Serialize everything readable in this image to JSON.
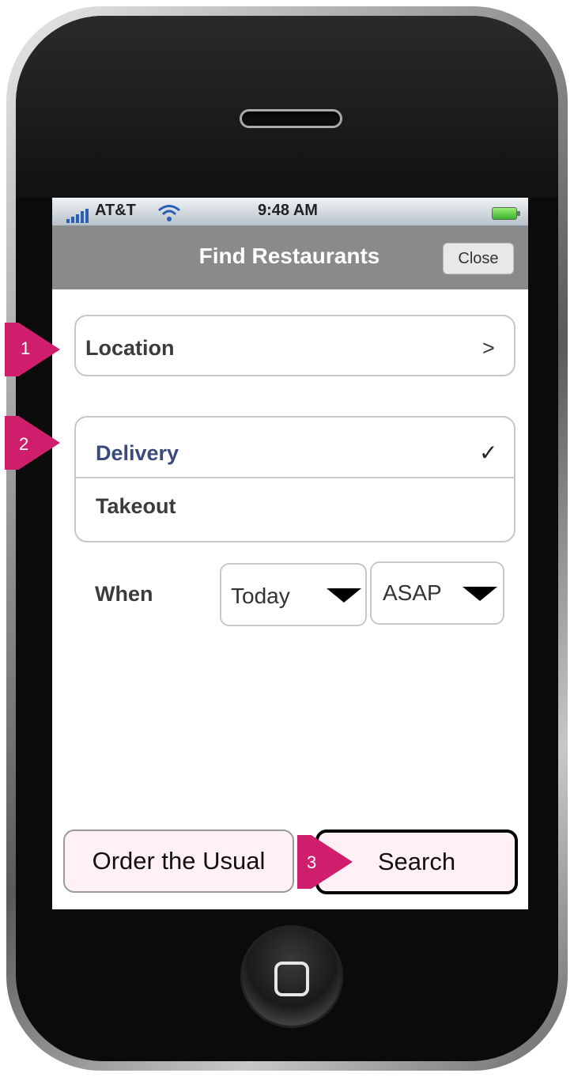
{
  "status_bar": {
    "carrier": "AT&T",
    "time": "9:48 AM",
    "signal_icon": "signal-bars-icon",
    "wifi_icon": "wifi-icon",
    "battery_icon": "battery-icon"
  },
  "nav_bar": {
    "title": "Find Restaurants",
    "close_label": "Close"
  },
  "location": {
    "label": "Location",
    "chevron": ">"
  },
  "order_type": {
    "options": [
      {
        "label": "Delivery",
        "selected": true
      },
      {
        "label": "Takeout",
        "selected": false
      }
    ],
    "check_glyph": "✓"
  },
  "when": {
    "label": "When",
    "day_value": "Today",
    "time_value": "ASAP"
  },
  "actions": {
    "order_usual_label": "Order the Usual",
    "search_label": "Search"
  },
  "callouts": [
    "1",
    "2",
    "3"
  ],
  "colors": {
    "nav_bar": "#8a8a8a",
    "selected_option": "#3b4a7d",
    "callout": "#cf1f6c",
    "button_fill": "#fff1f6"
  }
}
